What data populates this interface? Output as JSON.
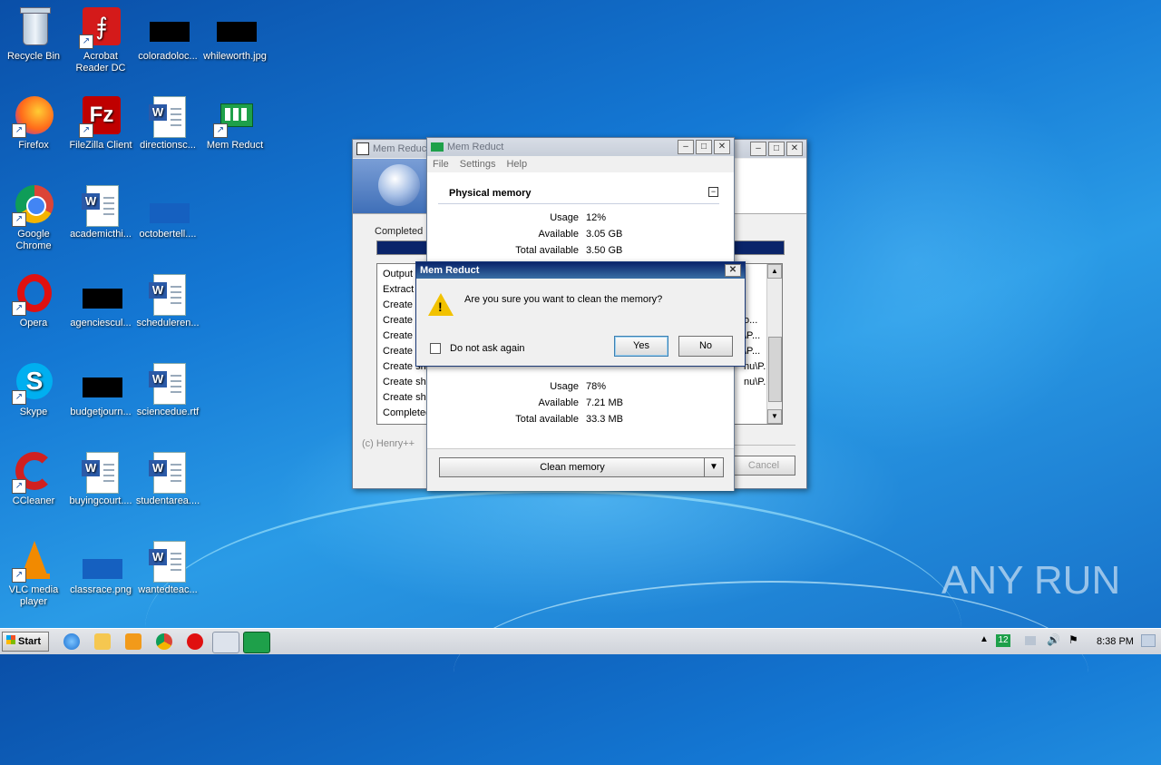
{
  "desktop": {
    "icons": [
      {
        "label": "Recycle Bin",
        "icon": "recycle-bin-icon"
      },
      {
        "label": "Acrobat Reader DC",
        "icon": "acrobat-icon"
      },
      {
        "label": "coloradoloc...",
        "icon": "image-file-icon"
      },
      {
        "label": "whileworth.jpg",
        "icon": "image-file-icon"
      },
      {
        "label": "Firefox",
        "icon": "firefox-icon"
      },
      {
        "label": "FileZilla Client",
        "icon": "filezilla-icon"
      },
      {
        "label": "directionsc...",
        "icon": "word-doc-icon"
      },
      {
        "label": "Mem Reduct",
        "icon": "mem-reduct-icon"
      },
      {
        "label": "Google Chrome",
        "icon": "chrome-icon"
      },
      {
        "label": "academicthi...",
        "icon": "word-doc-icon"
      },
      {
        "label": "octobertell....",
        "icon": "image-file-icon"
      },
      {
        "label": "Opera",
        "icon": "opera-icon"
      },
      {
        "label": "agenciescul...",
        "icon": "image-file-icon"
      },
      {
        "label": "scheduleren...",
        "icon": "word-doc-icon"
      },
      {
        "label": "Skype",
        "icon": "skype-icon"
      },
      {
        "label": "budgetjourn...",
        "icon": "image-file-icon"
      },
      {
        "label": "sciencedue.rtf",
        "icon": "word-doc-icon"
      },
      {
        "label": "CCleaner",
        "icon": "ccleaner-icon"
      },
      {
        "label": "buyingcourt....",
        "icon": "word-doc-icon"
      },
      {
        "label": "studentarea....",
        "icon": "word-doc-icon"
      },
      {
        "label": "VLC media player",
        "icon": "vlc-icon"
      },
      {
        "label": "classrace.png",
        "icon": "image-file-icon"
      },
      {
        "label": "wantedteac...",
        "icon": "word-doc-icon"
      }
    ]
  },
  "installer": {
    "title": "Mem Reduc",
    "status_label": "Completed",
    "log_lines": [
      "Output",
      "Extract",
      "Create",
      "Create",
      "Create",
      "Create",
      "Create sh",
      "Create sh",
      "Create sh",
      "Completed"
    ],
    "log_tail": [
      "o...",
      "\\P...",
      "\\P...",
      "nu\\P...",
      "nu\\P..."
    ],
    "footer": "(c) Henry++",
    "cancel_label": "Cancel"
  },
  "memreduct": {
    "title": "Mem Reduct",
    "menu": [
      "File",
      "Settings",
      "Help"
    ],
    "physical_title": "Physical memory",
    "physical": [
      {
        "label": "Usage",
        "value": "12%"
      },
      {
        "label": "Available",
        "value": "3.05 GB"
      },
      {
        "label": "Total available",
        "value": "3.50 GB"
      }
    ],
    "second": [
      {
        "label": "Usage",
        "value": "78%"
      },
      {
        "label": "Available",
        "value": "7.21 MB"
      },
      {
        "label": "Total available",
        "value": "33.3 MB"
      }
    ],
    "clean_label": "Clean memory"
  },
  "dialog": {
    "title": "Mem Reduct",
    "message": "Are you sure you want to clean the memory?",
    "checkbox_label": "Do not ask again",
    "yes_label": "Yes",
    "no_label": "No"
  },
  "taskbar": {
    "start_label": "Start",
    "tray_badge": "12",
    "clock": "8:38 PM"
  },
  "watermark": "ANY RUN"
}
